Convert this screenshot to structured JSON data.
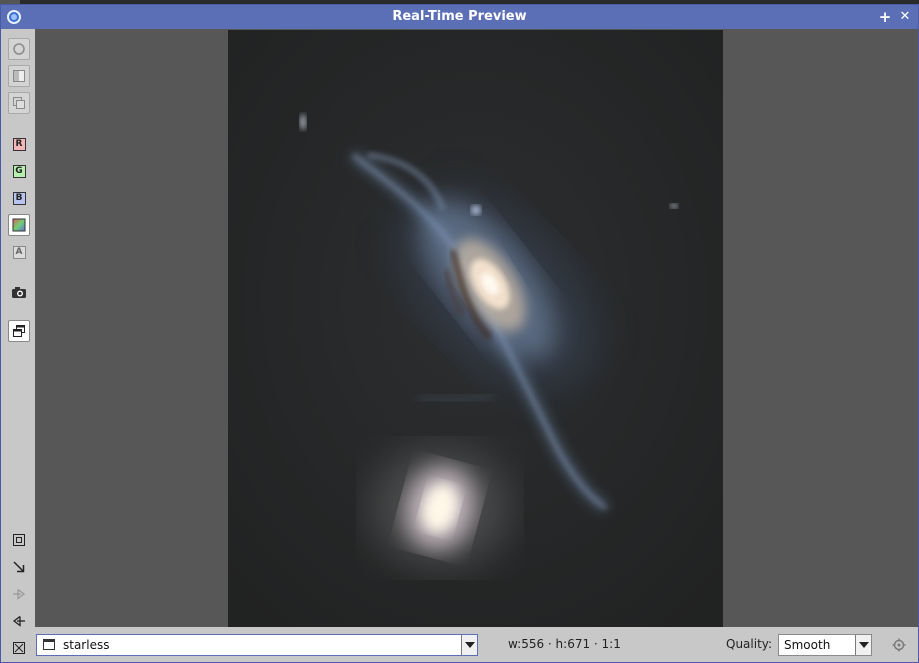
{
  "window": {
    "title": "Real-Time Preview",
    "title_bar_color": "#5b6fb7",
    "icon": "app-orb-icon",
    "controls": [
      {
        "name": "pin-icon",
        "glyph": "+"
      },
      {
        "name": "close-icon",
        "glyph": "✕"
      }
    ]
  },
  "toolbar": {
    "items": [
      {
        "name": "circle-tool-icon"
      },
      {
        "name": "split-view-icon"
      },
      {
        "name": "overlay-compare-icon"
      },
      {
        "name": "channel-r-button",
        "label": "R",
        "color": "#f4b6b6"
      },
      {
        "name": "channel-g-button",
        "label": "G",
        "color": "#b6f0b0"
      },
      {
        "name": "channel-b-button",
        "label": "B",
        "color": "#b8c4f0"
      },
      {
        "name": "rgb-composite-button",
        "active": true
      },
      {
        "name": "alpha-channel-button",
        "label": "A"
      },
      {
        "name": "camera-icon"
      },
      {
        "name": "new-window-icon"
      },
      {
        "name": "fit-view-icon"
      },
      {
        "name": "zoom-to-fit-arrow-icon"
      },
      {
        "name": "forward-arrow-icon"
      },
      {
        "name": "back-arrow-icon"
      },
      {
        "name": "full-screen-icon"
      }
    ]
  },
  "bottombar": {
    "view_name": "starless",
    "dimensions": "w:556 · h:671 · 1:1",
    "quality_label": "Quality:",
    "quality_value": "Smooth"
  },
  "colors": {
    "accent": "#5b6fb7",
    "panel": "#c8c8c8",
    "viewport": "#575757",
    "sky": "#262727"
  }
}
